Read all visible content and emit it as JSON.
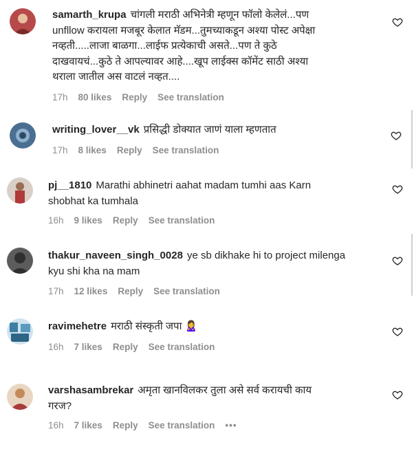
{
  "comments": [
    {
      "username": "samarth_krupa",
      "text": "चांगली मराठी अभिनेत्री म्हणून फॉलो केलेलं...पण\nunfllow करायला मजबूर केलात मॅडम...तुमच्याकडून अश्या पोस्ट अपेक्षा\nनव्हती.....लाजा बाळगा...लाईफ प्रत्येकाची असते...पण ते कुठे\nदाखवायचं...कुठे ते आपल्यावर आहे....खूप लाईक्स कॉमेंट साठी अश्या\nथराला जातील अस वाटलं नव्हत....",
      "time": "17h",
      "likes": "80 likes",
      "reply": "Reply",
      "translation": "See translation",
      "avatar_color": "#b64a4a"
    },
    {
      "username": "writing_lover__vk",
      "text": "प्रसिद्धी डोक्यात जाणं याला म्हणतात",
      "time": "17h",
      "likes": "8 likes",
      "reply": "Reply",
      "translation": "See translation",
      "avatar_color": "#4b6f91"
    },
    {
      "username": "pj__1810",
      "text": "Marathi abhinetri aahat madam tumhi aas Karn\nshobhat ka tumhala",
      "time": "16h",
      "likes": "9 likes",
      "reply": "Reply",
      "translation": "See translation",
      "avatar_color": "#9a6b55"
    },
    {
      "username": "thakur_naveen_singh_0028",
      "text": "ye sb dikhake hi to project milenga\nkyu shi kha na mam",
      "time": "17h",
      "likes": "12 likes",
      "reply": "Reply",
      "translation": "See translation",
      "avatar_color": "#2f2f2f"
    },
    {
      "username": "ravimehetre",
      "text": "मराठी संस्कृती जपा 🙎‍♀️",
      "time": "16h",
      "likes": "7 likes",
      "reply": "Reply",
      "translation": "See translation",
      "avatar_color": "#3d7fa3"
    },
    {
      "username": "varshasambrekar",
      "text": "अमृता खानविलकर तुला असे सर्व करायची काय\nगरज?",
      "time": "16h",
      "likes": "7 likes",
      "reply": "Reply",
      "translation": "See translation",
      "more": "•••",
      "avatar_color": "#c48a5a"
    }
  ],
  "icons": {
    "like": "heart-icon",
    "more": "more-options-icon"
  }
}
